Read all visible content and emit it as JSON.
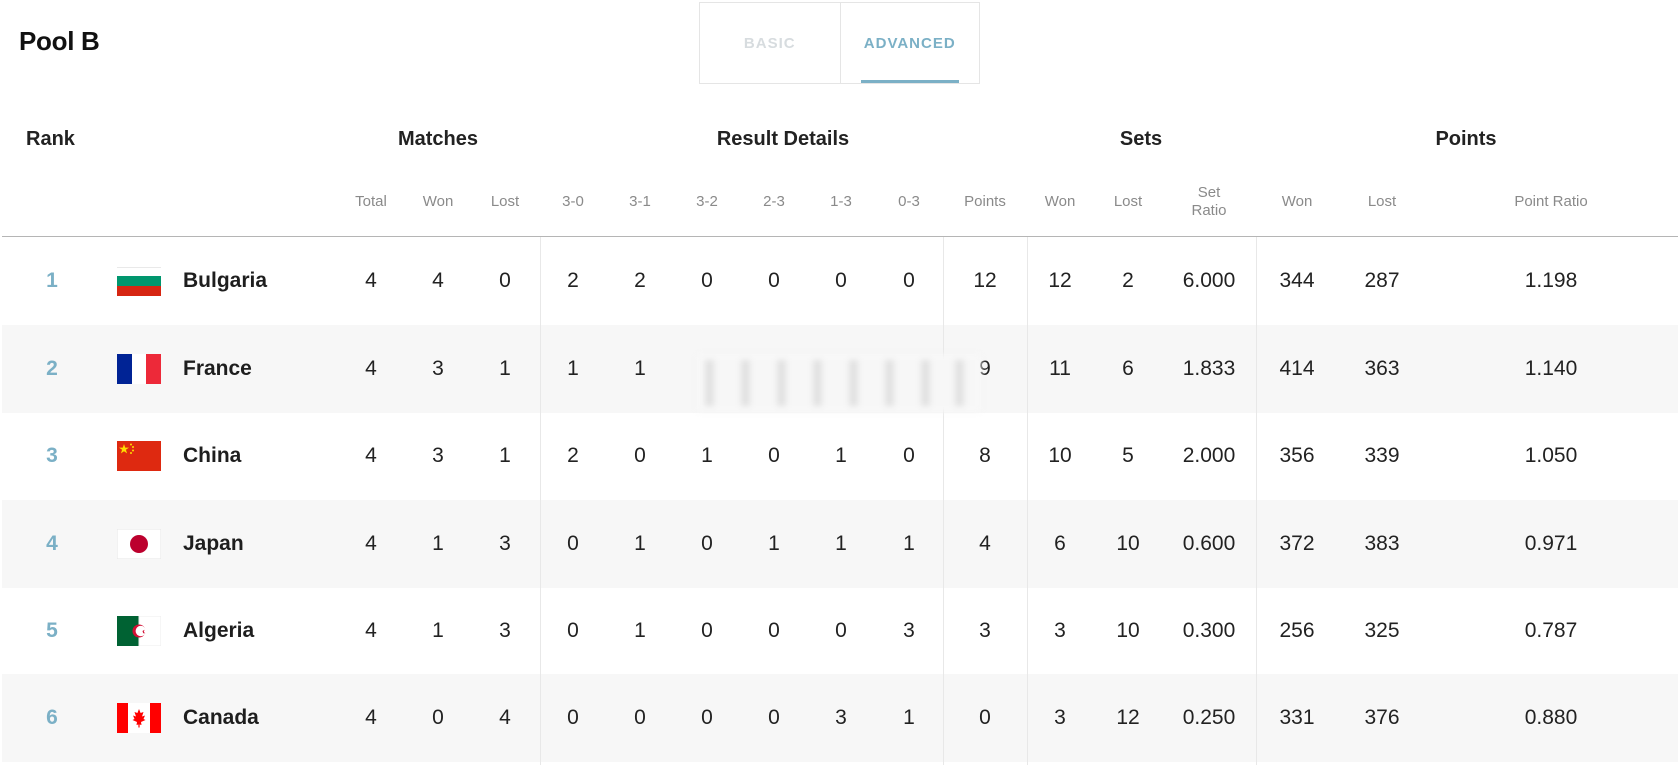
{
  "title": "Pool B",
  "tabs": [
    {
      "label": "BASIC",
      "active": false
    },
    {
      "label": "ADVANCED",
      "active": true
    }
  ],
  "groups": {
    "rank": "Rank",
    "matches": "Matches",
    "result_details": "Result Details",
    "sets": "Sets",
    "points": "Points"
  },
  "columns": [
    "Total",
    "Won",
    "Lost",
    "3-0",
    "3-1",
    "3-2",
    "2-3",
    "1-3",
    "0-3",
    "Points",
    "Won",
    "Lost",
    "Set Ratio",
    "Won",
    "Lost",
    "Point Ratio"
  ],
  "rows": [
    {
      "rank": "1",
      "team": "Bulgaria",
      "flag": "bulgaria-flag",
      "values": [
        "4",
        "4",
        "0",
        "2",
        "2",
        "0",
        "0",
        "0",
        "0",
        "12",
        "12",
        "2",
        "6.000",
        "344",
        "287",
        "1.198"
      ]
    },
    {
      "rank": "2",
      "team": "France",
      "flag": "france-flag",
      "values": [
        "4",
        "3",
        "1",
        "1",
        "1",
        "",
        "",
        "",
        "",
        "9",
        "11",
        "6",
        "1.833",
        "414",
        "363",
        "1.140"
      ]
    },
    {
      "rank": "3",
      "team": "China",
      "flag": "china-flag",
      "values": [
        "4",
        "3",
        "1",
        "2",
        "0",
        "1",
        "0",
        "1",
        "0",
        "8",
        "10",
        "5",
        "2.000",
        "356",
        "339",
        "1.050"
      ]
    },
    {
      "rank": "4",
      "team": "Japan",
      "flag": "japan-flag",
      "values": [
        "4",
        "1",
        "3",
        "0",
        "1",
        "0",
        "1",
        "1",
        "1",
        "4",
        "6",
        "10",
        "0.600",
        "372",
        "383",
        "0.971"
      ]
    },
    {
      "rank": "5",
      "team": "Algeria",
      "flag": "algeria-flag",
      "values": [
        "4",
        "1",
        "3",
        "0",
        "1",
        "0",
        "0",
        "0",
        "3",
        "3",
        "3",
        "10",
        "0.300",
        "256",
        "325",
        "0.787"
      ]
    },
    {
      "rank": "6",
      "team": "Canada",
      "flag": "canada-flag",
      "values": [
        "4",
        "0",
        "4",
        "0",
        "0",
        "0",
        "0",
        "3",
        "1",
        "0",
        "3",
        "12",
        "0.250",
        "331",
        "376",
        "0.880"
      ]
    }
  ],
  "colors": {
    "accent": "#7bb0c6",
    "inactive_tab": "#d7dcdf",
    "alt_row": "#f7f7f7"
  }
}
